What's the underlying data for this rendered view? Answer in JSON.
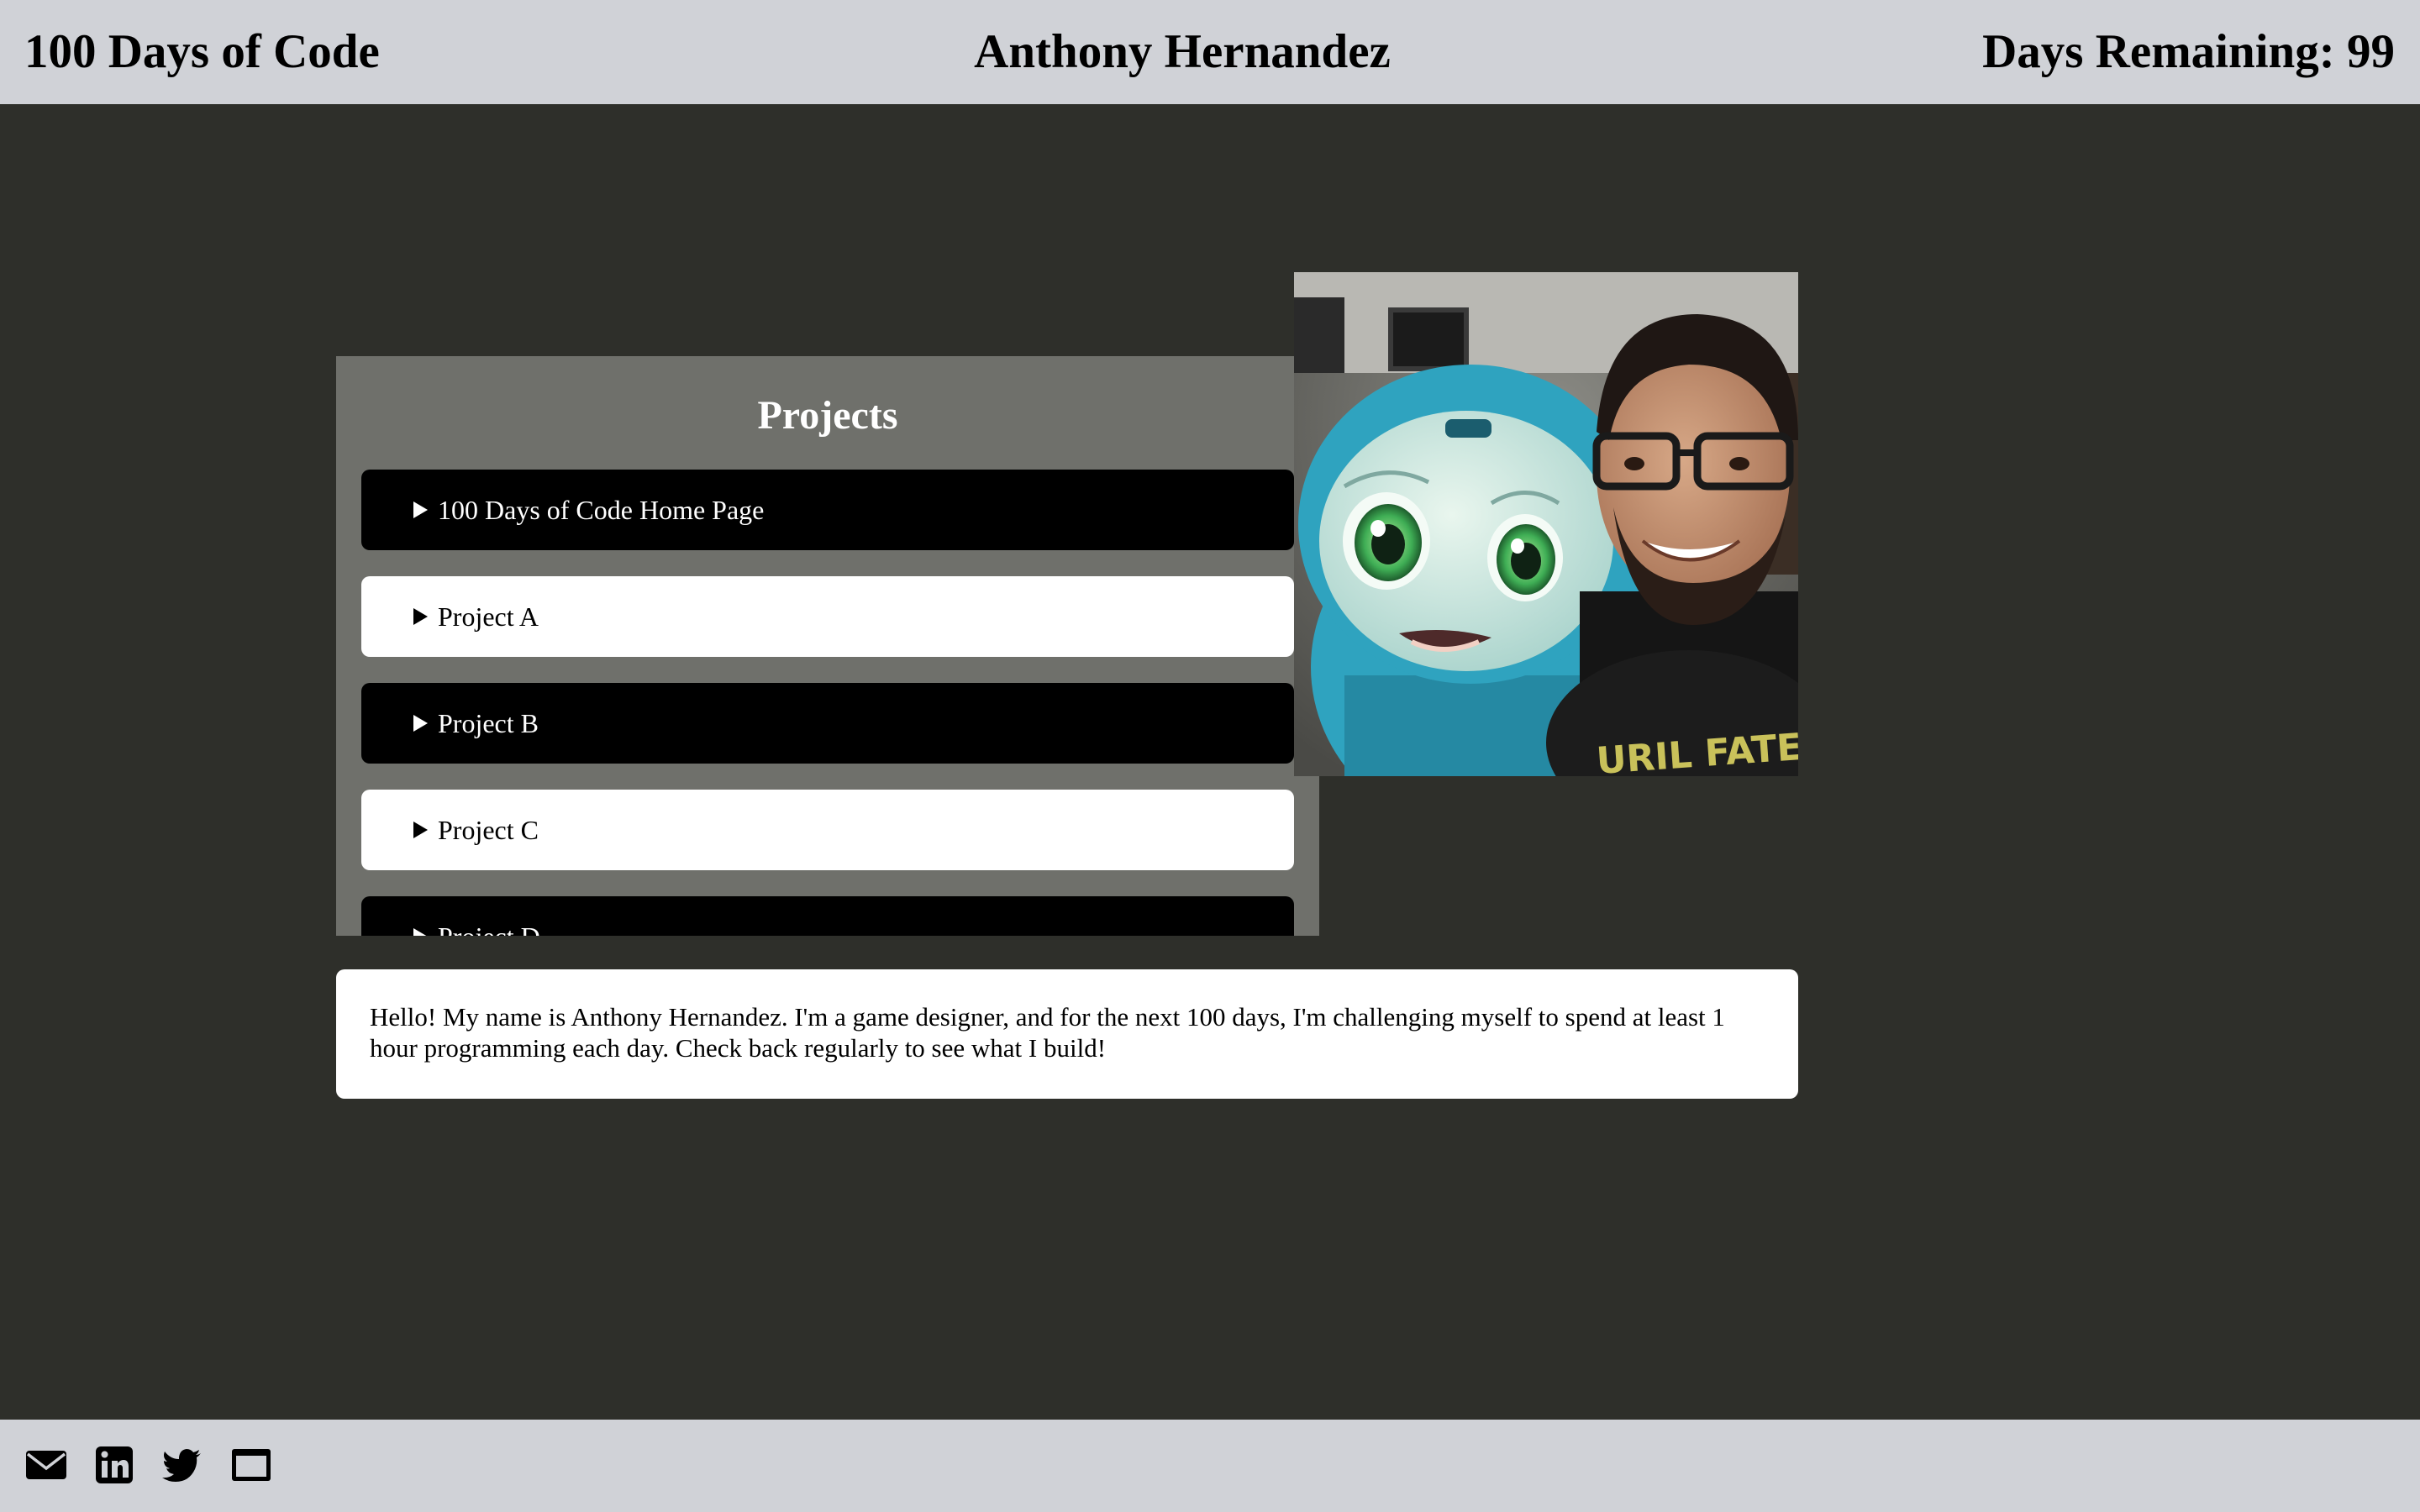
{
  "header": {
    "site_title": "100 Days of Code",
    "author_name": "Anthony Hernandez",
    "days_remaining": "Days Remaining: 99"
  },
  "projects": {
    "title": "Projects",
    "items": [
      {
        "label": "100 Days of Code Home Page"
      },
      {
        "label": "Project A"
      },
      {
        "label": "Project B"
      },
      {
        "label": "Project C"
      },
      {
        "label": "Project D"
      }
    ]
  },
  "intro": {
    "text": "Hello! My name is Anthony Hernandez. I'm a game designer, and for the next 100 days, I'm challenging myself to spend at least 1 hour programming each day. Check back regularly to see what I build!"
  },
  "footer": {
    "icons": [
      "envelope-icon",
      "linkedin-icon",
      "twitter-icon",
      "browser-window-icon"
    ]
  },
  "colors": {
    "header_bg": "#d0d2d7",
    "page_bg": "#2e2f2a",
    "panel_bg": "#6f706b",
    "robot_teal": "#2fa3bf"
  }
}
